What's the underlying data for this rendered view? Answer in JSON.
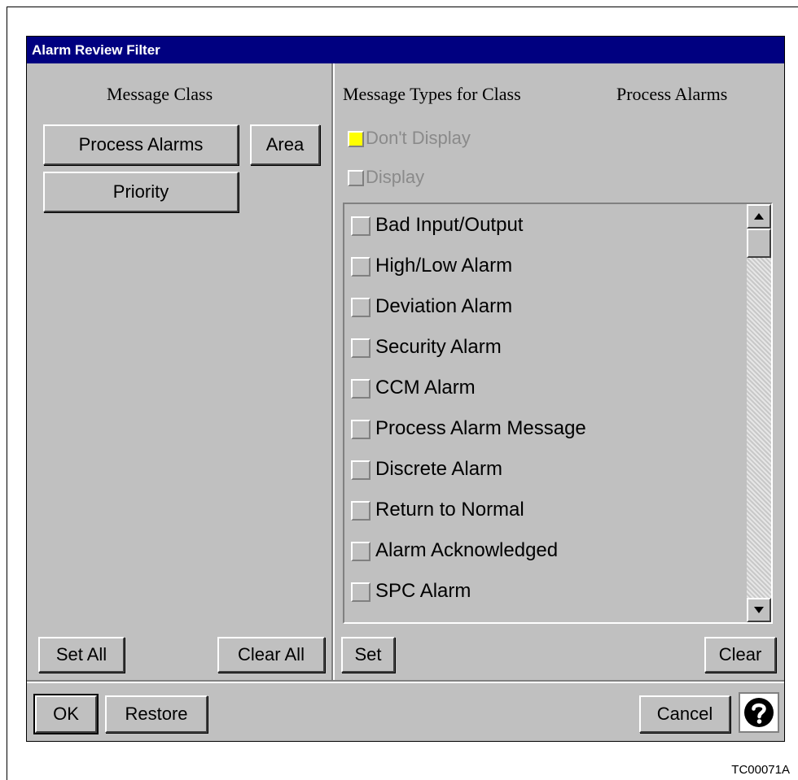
{
  "dialog": {
    "title": "Alarm Review Filter"
  },
  "left_panel": {
    "heading": "Message Class",
    "class_buttons": {
      "process_alarms": "Process Alarms",
      "area": "Area",
      "priority": "Priority"
    },
    "set_all": "Set All",
    "clear_all": "Clear All"
  },
  "right_panel": {
    "heading_prefix": "Message Types for Class",
    "heading_class": "Process Alarms",
    "dont_display": "Don't Display",
    "display": "Display",
    "items": [
      {
        "label": "Bad Input/Output"
      },
      {
        "label": "High/Low Alarm"
      },
      {
        "label": "Deviation Alarm"
      },
      {
        "label": "Security Alarm"
      },
      {
        "label": "CCM Alarm"
      },
      {
        "label": "Process Alarm Message"
      },
      {
        "label": "Discrete Alarm"
      },
      {
        "label": "Return to Normal"
      },
      {
        "label": "Alarm Acknowledged"
      },
      {
        "label": "SPC Alarm"
      }
    ],
    "set": "Set",
    "clear": "Clear"
  },
  "footer": {
    "ok": "OK",
    "restore": "Restore",
    "cancel": "Cancel"
  },
  "figure_code": "TC00071A",
  "colors": {
    "title_bar": "#000080",
    "dialog_bg": "#c0c0c0",
    "indicator_yellow": "#ffff00"
  },
  "icons": {
    "help": "question-mark-help-icon",
    "scroll_up": "arrow-up-icon",
    "scroll_down": "arrow-down-icon"
  }
}
